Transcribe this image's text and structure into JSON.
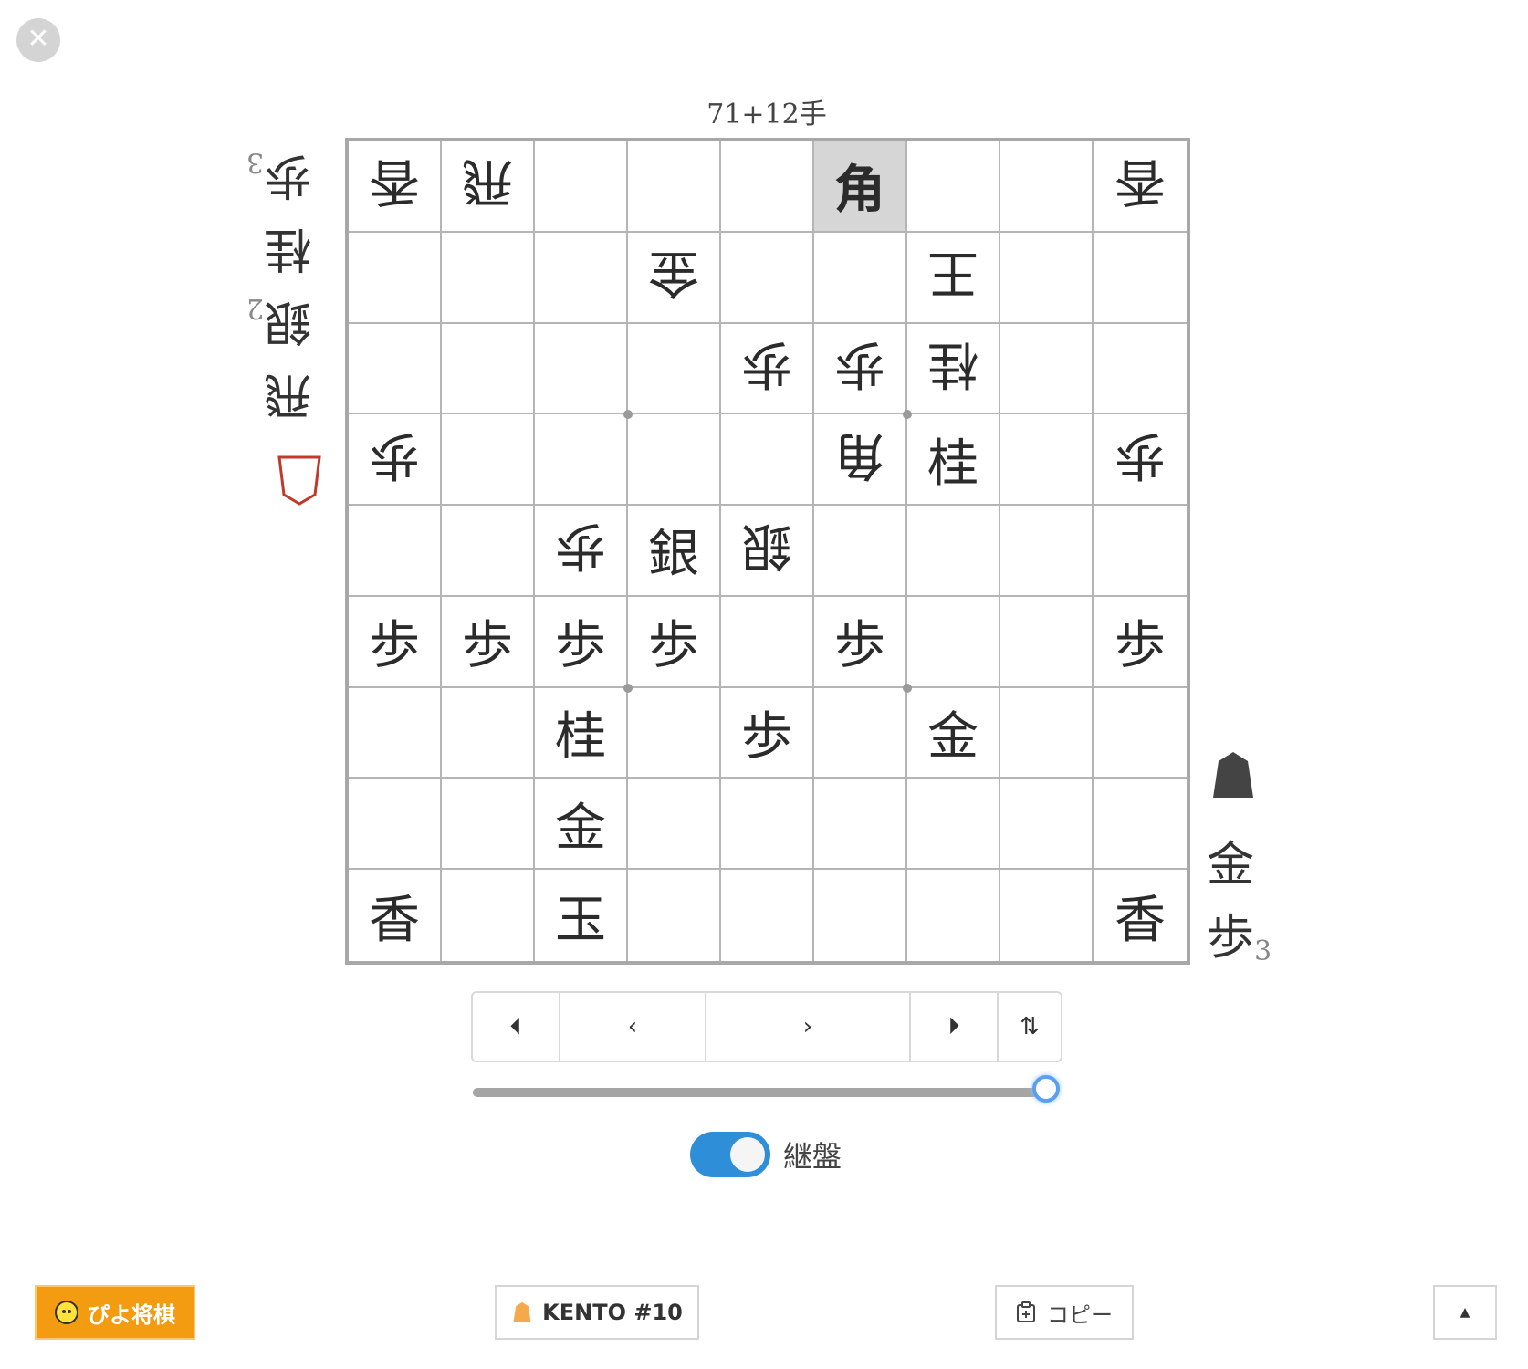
{
  "close_glyph": "✕",
  "move_count": "71+12手",
  "board": [
    [
      {
        "t": "香",
        "s": "g"
      },
      {
        "t": "飛",
        "s": "g"
      },
      null,
      null,
      null,
      {
        "t": "角",
        "s": "s",
        "hl": true
      },
      null,
      null,
      {
        "t": "香",
        "s": "g"
      }
    ],
    [
      null,
      null,
      null,
      {
        "t": "金",
        "s": "g"
      },
      null,
      null,
      {
        "t": "王",
        "s": "g"
      },
      null,
      null
    ],
    [
      null,
      null,
      null,
      null,
      {
        "t": "歩",
        "s": "g"
      },
      {
        "t": "歩",
        "s": "g"
      },
      {
        "t": "桂",
        "s": "g"
      },
      null,
      null
    ],
    [
      {
        "t": "歩",
        "s": "g"
      },
      null,
      null,
      null,
      null,
      {
        "t": "角",
        "s": "g"
      },
      {
        "t": "桂",
        "s": "s"
      },
      null,
      {
        "t": "歩",
        "s": "g"
      }
    ],
    [
      null,
      null,
      {
        "t": "歩",
        "s": "g"
      },
      {
        "t": "銀",
        "s": "s"
      },
      {
        "t": "銀",
        "s": "g"
      },
      null,
      null,
      null,
      null
    ],
    [
      {
        "t": "歩",
        "s": "s"
      },
      {
        "t": "歩",
        "s": "s"
      },
      {
        "t": "歩",
        "s": "s"
      },
      {
        "t": "歩",
        "s": "s"
      },
      null,
      {
        "t": "歩",
        "s": "s"
      },
      null,
      null,
      {
        "t": "歩",
        "s": "s"
      }
    ],
    [
      null,
      null,
      {
        "t": "桂",
        "s": "s"
      },
      null,
      {
        "t": "歩",
        "s": "s"
      },
      null,
      {
        "t": "金",
        "s": "s"
      },
      null,
      null
    ],
    [
      null,
      null,
      {
        "t": "金",
        "s": "s"
      },
      null,
      null,
      null,
      null,
      null,
      null
    ],
    [
      {
        "t": "香",
        "s": "s"
      },
      null,
      {
        "t": "玉",
        "s": "s"
      },
      null,
      null,
      null,
      null,
      null,
      {
        "t": "香",
        "s": "s"
      }
    ]
  ],
  "gote_hand": [
    {
      "piece": "飛",
      "count": ""
    },
    {
      "piece": "銀",
      "count": "2"
    },
    {
      "piece": "桂",
      "count": ""
    },
    {
      "piece": "歩",
      "count": "3"
    }
  ],
  "sente_hand": [
    {
      "piece": "金",
      "count": ""
    },
    {
      "piece": "歩",
      "count": "3"
    }
  ],
  "controls": {
    "first": "⏴",
    "prev": "‹",
    "next": "›",
    "last": "⏵",
    "flip": "⇅"
  },
  "slider": {
    "value": 1.0
  },
  "toggle": {
    "label": "継盤",
    "on": true
  },
  "footer": {
    "piyo": "ぴよ将棋",
    "kento": "KENTO #10",
    "copy": "コピー",
    "top": "▲"
  },
  "colors": {
    "accent": "#2e8fd8",
    "piyo": "#f39b11",
    "highlight": "#d6d6d6",
    "gote_marker": "#c0392b"
  }
}
